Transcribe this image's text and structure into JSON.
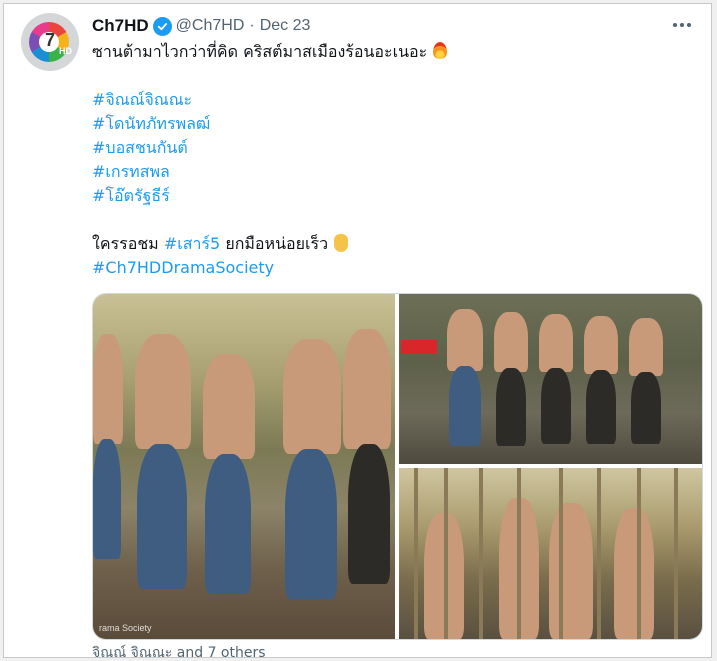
{
  "tweet": {
    "display_name": "Ch7HD",
    "handle": "@Ch7HD",
    "separator": "·",
    "date": "Dec 23",
    "line1": "ซานต้ามาไวกว่าที่คิด คริสต์มาสเมืองร้อนอะเนอะ",
    "hashtags": [
      "#จิณณ์จิณณะ",
      "#โดนัทภัทรพลฒ์",
      "#บอสชนกันต์",
      "#เกรทสพล",
      "#โอ๊ตรัฐธีร์"
    ],
    "cta_prefix": "ใครรอชม",
    "cta_tag": "#เสาร์5",
    "cta_suffix": "ยกมือหน่อยเร็ว",
    "last_tag": "#Ch7HDDramaSociety",
    "image_watermark": "rama Society",
    "tagged_people": "จิณณ์ จิณณะ and 7 others"
  },
  "icons": {
    "avatar": "ch7-logo",
    "verified": "verified-badge-icon",
    "more": "more-options-icon",
    "emoji1": "fire-emoji",
    "emoji2": "raised-hand-emoji"
  },
  "colors": {
    "accent": "#1d9bf0",
    "muted": "#536471",
    "text": "#0f1419"
  }
}
